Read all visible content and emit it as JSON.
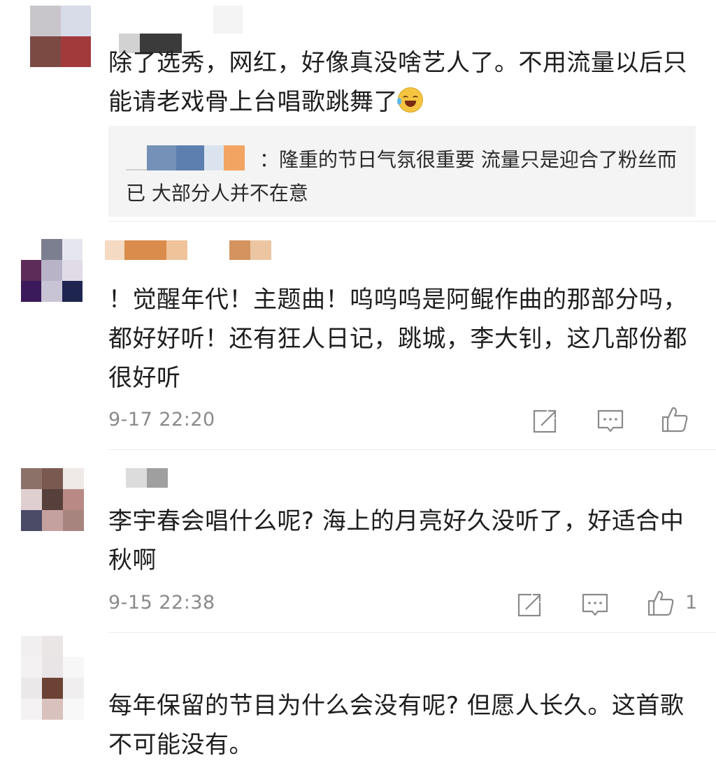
{
  "comments": [
    {
      "text": "除了选秀，网红，好像真没啥艺人了。不用流量以后只能请老戏骨上台唱歌跳舞了",
      "emoji": "laughing-crying-emoji",
      "reply": {
        "separator": "：",
        "text": "隆重的节日气氛很重要 流量只是迎合了粉丝而已 大部分人并不在意"
      }
    },
    {
      "text": "！觉醒年代！主题曲！呜呜呜是阿鲲作曲的那部分吗，都好好听！还有狂人日记，跳城，李大钊，这几部份都很好听",
      "time": "9-17 22:20",
      "likes": ""
    },
    {
      "text": "李宇春会唱什么呢? 海上的月亮好久没听了，好适合中秋啊",
      "time": "9-15 22:38",
      "likes": "1"
    },
    {
      "text": "每年保留的节目为什么会没有呢? 但愿人长久。这首歌不可能没有。"
    }
  ],
  "icons": {
    "share": "share-icon",
    "comment": "comment-icon",
    "like": "thumbs-up-icon"
  },
  "colors": {
    "text": "#1e1e1e",
    "meta": "#8a8a8a",
    "reply_bg": "#f4f4f4"
  }
}
